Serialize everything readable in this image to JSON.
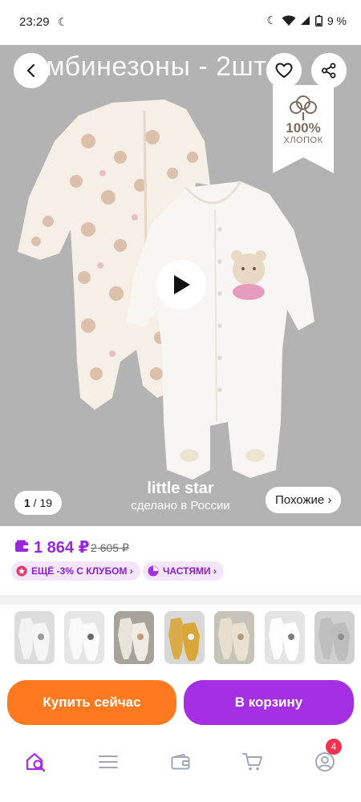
{
  "status_bar": {
    "time": "23:29",
    "battery": "9 %"
  },
  "product": {
    "image_title": "комбинезоны - 2шт",
    "badge": {
      "percent": "100%",
      "word": "ХЛОПОК"
    },
    "brand": "little star",
    "made_in": "сделано в России",
    "counter_current": "1",
    "counter_sep": " / ",
    "counter_total": "19",
    "similar_label": "Похожие ›"
  },
  "price": {
    "current": "1 864 ₽",
    "old": "2 605 ₽"
  },
  "chips": {
    "club": "ЕЩЁ -3% С КЛУБОМ ›",
    "parts": "ЧАСТЯМИ ›"
  },
  "thumbnails": [
    {
      "bg": "#dcdcdc",
      "garment": "#f5f5f5",
      "accent": "#9a9a9a"
    },
    {
      "bg": "#e6e6e6",
      "garment": "#fbfbfb",
      "accent": "#6a6a6a"
    },
    {
      "bg": "#a7a39a",
      "garment": "#f0ebe3",
      "accent": "#c49a77"
    },
    {
      "bg": "#d8d8d8",
      "garment": "#d9a63a",
      "accent": "#f4f4f4"
    },
    {
      "bg": "#c8c3b8",
      "garment": "#e9e2d3",
      "accent": "#b69d7a"
    },
    {
      "bg": "#e4e4e4",
      "garment": "#ffffff",
      "accent": "#7d7d7d"
    },
    {
      "bg": "#d0d0d0",
      "garment": "#bdbdbd",
      "accent": "#8d8d8d"
    }
  ],
  "actions": {
    "buy_now": "Купить сейчас",
    "add_to_cart": "В корзину"
  },
  "nav": {
    "cart_badge": "4",
    "active_color": "#a42fe3",
    "inactive_color": "#a0a7b8"
  }
}
